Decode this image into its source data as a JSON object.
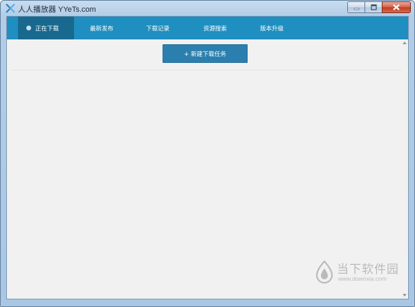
{
  "window": {
    "title": "人人播放器 YYeTs.com"
  },
  "window_controls": [
    "minimize-icon",
    "restore-icon",
    "close-icon"
  ],
  "nav": {
    "tabs": [
      {
        "label": "正在下载",
        "active": true
      },
      {
        "label": "最新发布",
        "active": false
      },
      {
        "label": "下载记录",
        "active": false
      },
      {
        "label": "资源搜索",
        "active": false
      },
      {
        "label": "版本升级",
        "active": false
      }
    ]
  },
  "main": {
    "new_task_label": "+ 新建下载任务"
  },
  "watermark": {
    "name": "当下软件园",
    "url": "www.downxia.com"
  },
  "colors": {
    "nav_bar": "#1e8fc0",
    "active_tab": "#19698f",
    "button": "#2b7fae",
    "content_bg": "#f1f1f1"
  }
}
